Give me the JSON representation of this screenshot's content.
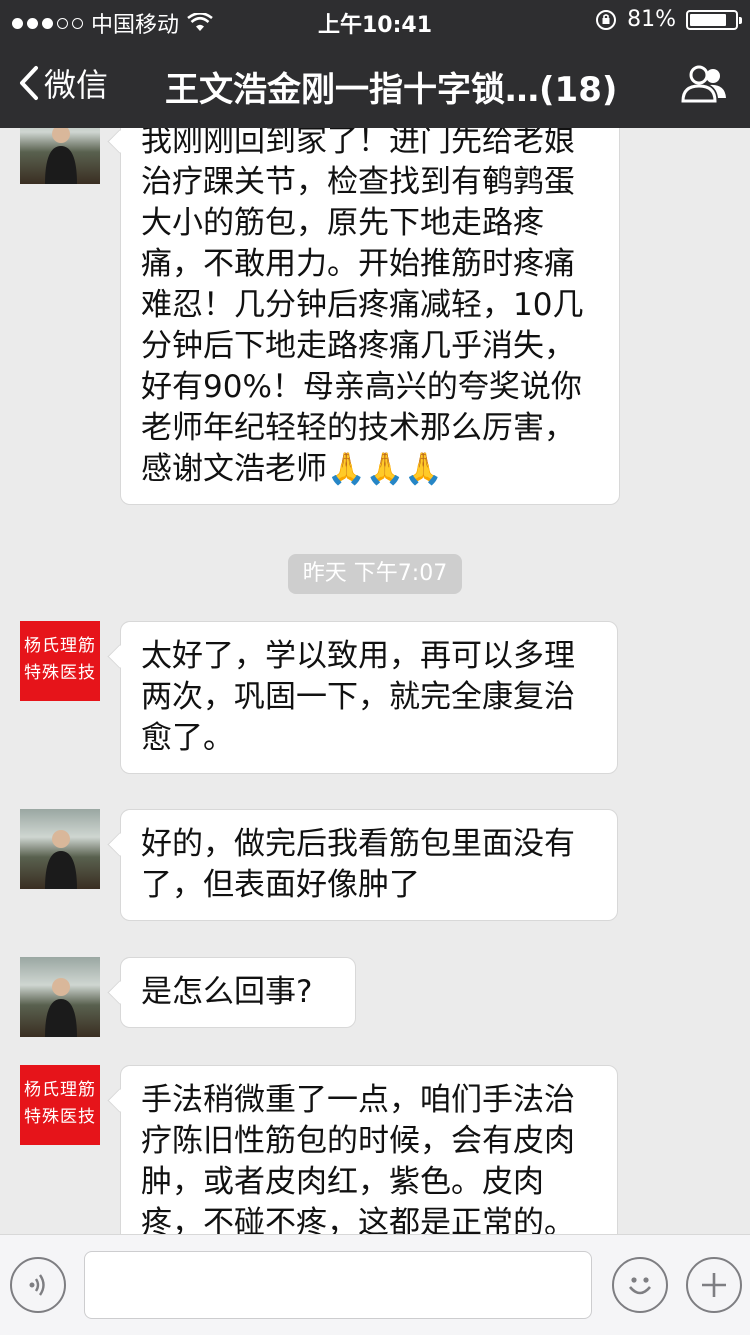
{
  "status_bar": {
    "carrier": "中国移动",
    "time": "上午10:41",
    "battery": "81%",
    "battery_level": 0.81,
    "signal_icon": "signal-dots-icon",
    "wifi_icon": "wifi-icon",
    "lock_icon": "rotation-lock-icon"
  },
  "nav": {
    "back_label": "微信",
    "title": "王文浩金刚一指十字锁…(18)",
    "group_icon": "group-members-icon"
  },
  "messages": [
    {
      "avatar": "photo",
      "text": "我刚刚回到家了！进门先给老娘治疗踝关节，检查找到有鹌鹑蛋大小的筋包，原先下地走路疼痛，不敢用力。开始推筋时疼痛难忍！几分钟后疼痛减轻，10几分钟后下地走路疼痛几乎消失，好有90%！母亲高兴的夸奖说你老师年纪轻轻的技术那么厉害，感谢文浩老师🙏🙏🙏"
    },
    {
      "avatar": "red",
      "avatar_text": [
        "杨氏理筋",
        "特殊医技"
      ],
      "text": "太好了，学以致用，再可以多理两次，巩固一下，就完全康复治愈了。"
    },
    {
      "avatar": "photo",
      "text": "好的，做完后我看筋包里面没有了，但表面好像肿了"
    },
    {
      "avatar": "photo",
      "text": "是怎么回事?"
    },
    {
      "avatar": "red",
      "avatar_text": [
        "杨氏理筋",
        "特殊医技"
      ],
      "text": "手法稍微重了一点，咱们手法治疗陈旧性筋包的时候，会有皮肉肿，或者皮肉红，紫色。皮肉疼，不碰不疼，这都是正常的。"
    }
  ],
  "timestamp": "昨天 下午7:07",
  "input_bar": {
    "voice_icon": "voice-icon",
    "emoji_icon": "emoji-icon",
    "plus_icon": "plus-icon",
    "placeholder": ""
  }
}
